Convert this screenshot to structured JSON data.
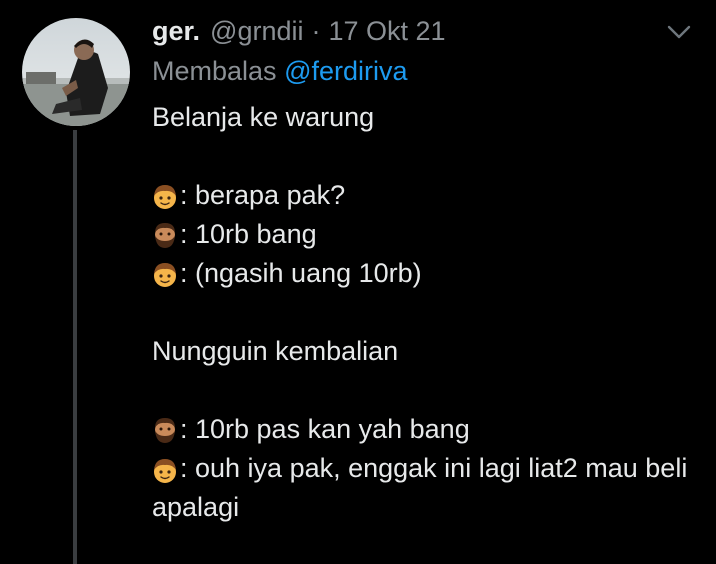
{
  "tweet": {
    "author_name": "ger.",
    "author_handle": "@grndii",
    "separator": "·",
    "date": "17 Okt 21",
    "reply_prefix": "Membalas",
    "reply_mention": "@ferdiriva",
    "lines": {
      "l1": "Belanja ke warung",
      "l2": ": berapa pak?",
      "l3": ": 10rb bang",
      "l4": ": (ngasih uang 10rb)",
      "l5": "Nungguin kembalian",
      "l6": ": 10rb pas kan yah bang",
      "l7": ": ouh iya pak, enggak ini lagi liat2 mau beli apalagi"
    }
  },
  "icons": {
    "boy": "boy-emoji-icon",
    "bearded": "bearded-man-emoji-icon",
    "more": "chevron-down-icon"
  },
  "colors": {
    "background": "#000000",
    "text": "#e7e9ea",
    "muted": "#8b9095",
    "link": "#1d9bf0"
  }
}
